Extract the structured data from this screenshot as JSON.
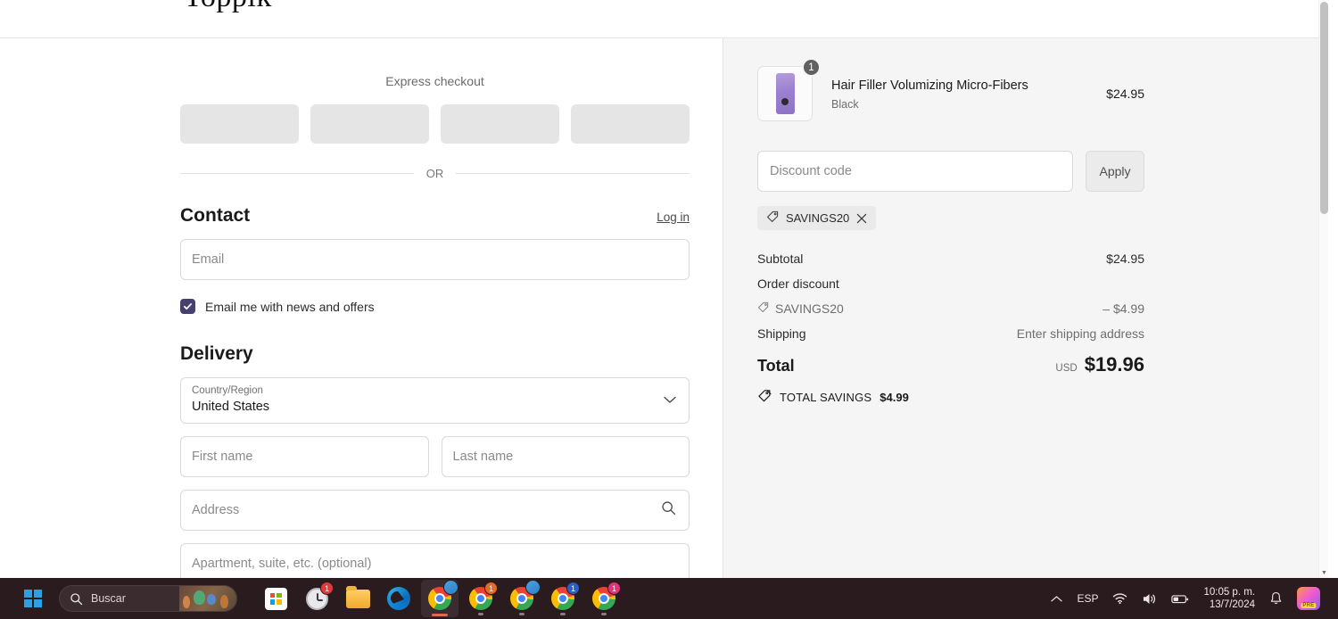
{
  "header": {
    "logo_text": "Toppik",
    "logo_tm": "™"
  },
  "express": {
    "title": "Express checkout",
    "button_count": 4,
    "or_text": "OR"
  },
  "contact": {
    "title": "Contact",
    "login_label": "Log in",
    "email_placeholder": "Email",
    "newsletter_label": "Email me with news and offers",
    "newsletter_checked": true,
    "checkbox_color": "#45406e"
  },
  "delivery": {
    "title": "Delivery",
    "country": {
      "label": "Country/Region",
      "value": "United States"
    },
    "first_name_placeholder": "First name",
    "last_name_placeholder": "Last name",
    "address_placeholder": "Address",
    "apartment_placeholder": "Apartment, suite, etc. (optional)"
  },
  "summary": {
    "line_item": {
      "quantity": "1",
      "title": "Hair Filler Volumizing Micro-Fibers",
      "variant": "Black",
      "price": "$24.95"
    },
    "discount": {
      "placeholder": "Discount code",
      "apply_label": "Apply",
      "applied_code": "SAVINGS20"
    },
    "totals": [
      {
        "label": "Subtotal",
        "value": "$24.95",
        "muted": false,
        "icon": false
      },
      {
        "label": "Order discount",
        "value": "",
        "muted": false,
        "icon": false
      },
      {
        "label": "SAVINGS20",
        "value": "– $4.99",
        "muted": true,
        "icon": true
      },
      {
        "label": "Shipping",
        "value": "Enter shipping address",
        "muted": true,
        "icon": false
      }
    ],
    "total": {
      "label": "Total",
      "currency": "USD",
      "amount": "$19.96"
    },
    "savings": {
      "label": "TOTAL SAVINGS",
      "amount": "$4.99"
    }
  },
  "taskbar": {
    "search_placeholder": "Buscar",
    "apps": [
      {
        "name": "microsoft-store",
        "badge": ""
      },
      {
        "name": "clock",
        "badge": "1"
      },
      {
        "name": "file-explorer",
        "badge": ""
      },
      {
        "name": "microsoft-edge",
        "badge": ""
      },
      {
        "name": "google-chrome",
        "badge": ""
      },
      {
        "name": "google-chrome",
        "badge": "1"
      },
      {
        "name": "google-chrome",
        "badge": ""
      },
      {
        "name": "google-chrome",
        "badge": "1"
      },
      {
        "name": "google-chrome",
        "badge": "1"
      }
    ],
    "tray": {
      "language": "ESP",
      "time": "10:05 p. m.",
      "date": "13/7/2024",
      "copilot_tag": "PRE"
    }
  }
}
